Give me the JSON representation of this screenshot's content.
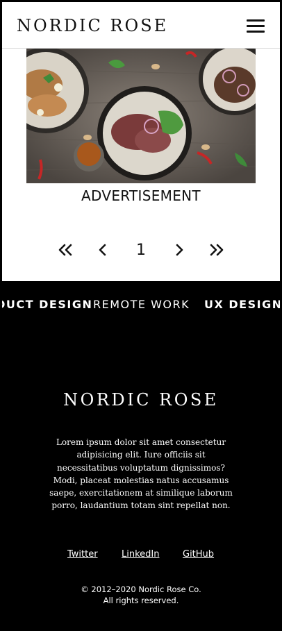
{
  "header": {
    "logo": "NORDIC ROSE",
    "menu_icon": "hamburger-menu-icon"
  },
  "advertisement": {
    "label": "ADVERTISEMENT",
    "image_icon": "food-photo"
  },
  "pagination": {
    "first_icon": "double-chevron-left-icon",
    "prev_icon": "chevron-left-icon",
    "current_page": "1",
    "next_icon": "chevron-right-icon",
    "last_icon": "double-chevron-right-icon"
  },
  "ticker": {
    "tags": [
      "PRODUCT DESIGN",
      "REMOTE WORK",
      "UX DESIGN"
    ]
  },
  "footer": {
    "logo": "NORDIC ROSE",
    "description": "Lorem ipsum dolor sit amet consectetur adipisicing elit. Iure officiis sit necessitatibus voluptatum dignissimos? Modi, placeat molestias natus accusamus saepe, exercitationem at similique laborum porro, laudantium totam sint repellat non.",
    "links": [
      "Twitter",
      "LinkedIn",
      "GitHub"
    ],
    "copyright_line1": "© 2012–2020 Nordic Rose Co.",
    "copyright_line2": "All rights reserved."
  },
  "colors": {
    "background_dark": "#000000",
    "background_light": "#ffffff",
    "text_dark": "#111111"
  }
}
